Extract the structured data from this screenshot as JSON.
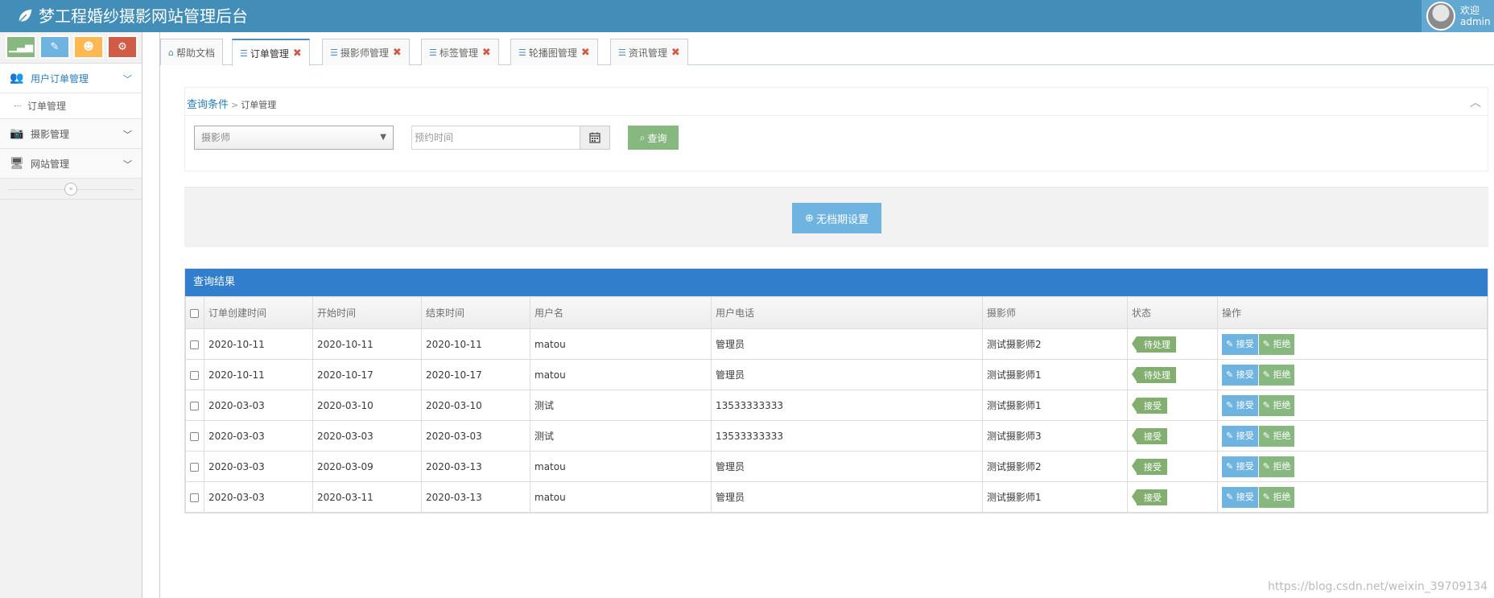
{
  "app": {
    "title": "梦工程婚纱摄影网站管理后台",
    "user_welcome": "欢迎",
    "user_name": "admin"
  },
  "sidebar": {
    "shortcuts": [
      {
        "name": "stats-icon",
        "color": "#87b87f"
      },
      {
        "name": "pencil-icon",
        "color": "#6fb3e0"
      },
      {
        "name": "users-icon",
        "color": "#ffb752"
      },
      {
        "name": "cogs-icon",
        "color": "#d15b47"
      }
    ],
    "items": [
      {
        "label": "用户订单管理",
        "icon": "users-icon"
      },
      {
        "label": "订单管理",
        "icon": ""
      },
      {
        "label": "摄影管理",
        "icon": "camera-icon"
      },
      {
        "label": "网站管理",
        "icon": "desktop-icon"
      }
    ]
  },
  "tabs": [
    {
      "label": "帮助文档",
      "icon": "home-icon",
      "closable": false
    },
    {
      "label": "订单管理",
      "icon": "sliders-icon",
      "closable": true
    },
    {
      "label": "摄影师管理",
      "icon": "sliders-icon",
      "closable": true
    },
    {
      "label": "标签管理",
      "icon": "sliders-icon",
      "closable": true
    },
    {
      "label": "轮播图管理",
      "icon": "sliders-icon",
      "closable": true
    },
    {
      "label": "资讯管理",
      "icon": "sliders-icon",
      "closable": true
    }
  ],
  "query": {
    "breadcrumb_root": "查询条件",
    "breadcrumb_current": "订单管理",
    "photographer_placeholder": "摄影师",
    "date_placeholder": "预约时间",
    "search_label": "查询"
  },
  "nonschedule": {
    "label": "无档期设置"
  },
  "results": {
    "title": "查询结果",
    "columns": [
      "订单创建时间",
      "开始时间",
      "结束时间",
      "用户名",
      "用户电话",
      "摄影师",
      "状态",
      "操作"
    ],
    "accept_label": "接受",
    "reject_label": "拒绝",
    "rows": [
      {
        "created": "2020-10-11",
        "start": "2020-10-11",
        "end": "2020-10-11",
        "username": "matou",
        "phone": "管理员",
        "photographer": "测试摄影师2",
        "status": "待处理"
      },
      {
        "created": "2020-10-11",
        "start": "2020-10-17",
        "end": "2020-10-17",
        "username": "matou",
        "phone": "管理员",
        "photographer": "测试摄影师1",
        "status": "待处理"
      },
      {
        "created": "2020-03-03",
        "start": "2020-03-10",
        "end": "2020-03-10",
        "username": "测试",
        "phone": "13533333333",
        "photographer": "测试摄影师1",
        "status": "接受"
      },
      {
        "created": "2020-03-03",
        "start": "2020-03-03",
        "end": "2020-03-03",
        "username": "测试",
        "phone": "13533333333",
        "photographer": "测试摄影师3",
        "status": "接受"
      },
      {
        "created": "2020-03-03",
        "start": "2020-03-09",
        "end": "2020-03-13",
        "username": "matou",
        "phone": "管理员",
        "photographer": "测试摄影师2",
        "status": "接受"
      },
      {
        "created": "2020-03-03",
        "start": "2020-03-11",
        "end": "2020-03-13",
        "username": "matou",
        "phone": "管理员",
        "photographer": "测试摄影师1",
        "status": "接受"
      }
    ]
  },
  "watermark": "https://blog.csdn.net/weixin_39709134"
}
